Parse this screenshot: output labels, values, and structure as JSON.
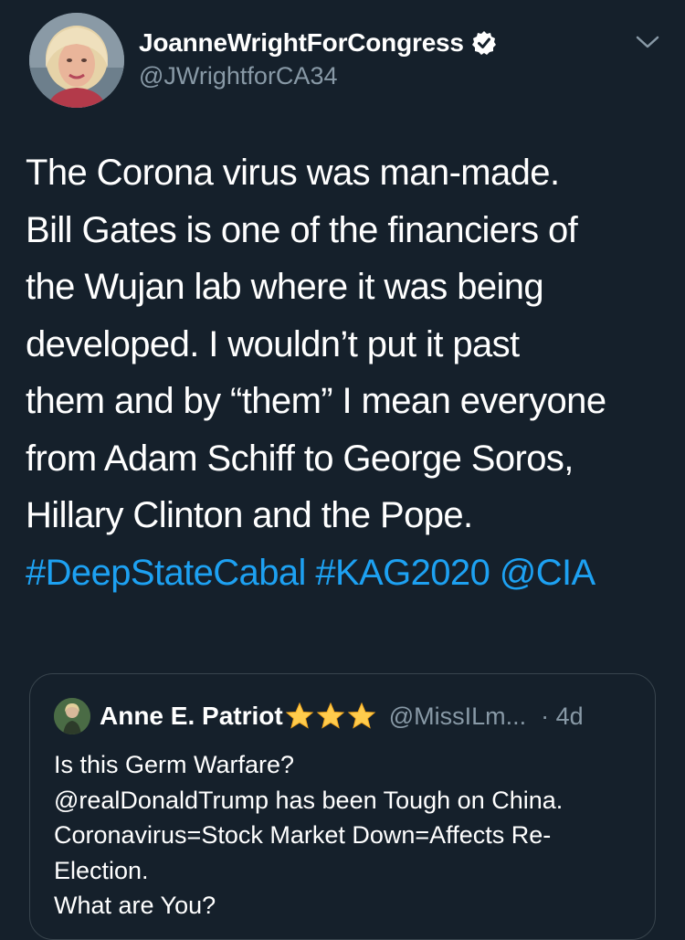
{
  "author": {
    "display_name": "JoanneWrightForCongress",
    "handle": "@JWrightforCA34",
    "verified": true,
    "avatar_icon": "profile-photo"
  },
  "tweet": {
    "lines": [
      "The Corona virus was man-made.",
      "Bill Gates is one of  the financiers of",
      "the Wujan lab where it was being",
      "developed.  I wouldn’t put it past",
      "them and by “them” I mean everyone",
      "from Adam Schiff to George Soros,",
      "Hillary Clinton and the Pope."
    ],
    "tags": [
      "#DeepStateCabal",
      "#KAG2020",
      "@CIA"
    ],
    "link_color": "#1da1f2"
  },
  "quoted_tweet": {
    "display_name": "Anne E. Patriot",
    "name_emoji": [
      "star",
      "star",
      "star"
    ],
    "handle": "@MissILm...",
    "time": "· 4d",
    "lines": [
      "Is this Germ Warfare?",
      "@realDonaldTrump has been Tough on China.",
      "Coronavirus=Stock Market Down=Affects Re-",
      "Election.",
      "What are You?"
    ]
  },
  "theme": {
    "background": "#15202b",
    "secondary_text": "#8899a6",
    "border": "#38444d"
  }
}
